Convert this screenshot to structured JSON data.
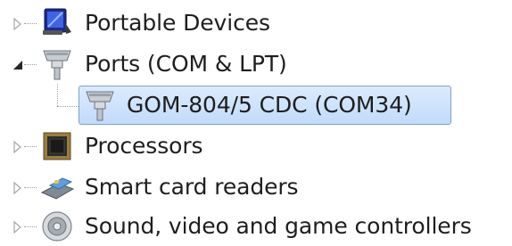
{
  "tree": {
    "items": [
      {
        "label": "Portable Devices",
        "expanded": false,
        "icon": "portable-device-icon",
        "level": 0
      },
      {
        "label": "Ports (COM & LPT)",
        "expanded": true,
        "icon": "port-connector-icon",
        "level": 0
      },
      {
        "label": "GOM-804/5 CDC (COM34)",
        "selected": true,
        "icon": "port-connector-icon",
        "level": 1
      },
      {
        "label": "Processors",
        "expanded": false,
        "icon": "processor-icon",
        "level": 0
      },
      {
        "label": "Smart card readers",
        "expanded": false,
        "icon": "smart-card-reader-icon",
        "level": 0
      },
      {
        "label": "Sound, video and game controllers",
        "expanded": false,
        "icon": "speaker-icon",
        "level": 0
      }
    ]
  },
  "colors": {
    "selection_border": "#7da2ce",
    "selection_fill_top": "#dcebfc",
    "selection_fill_bottom": "#c1dbfc",
    "text": "#1e1e1e"
  }
}
